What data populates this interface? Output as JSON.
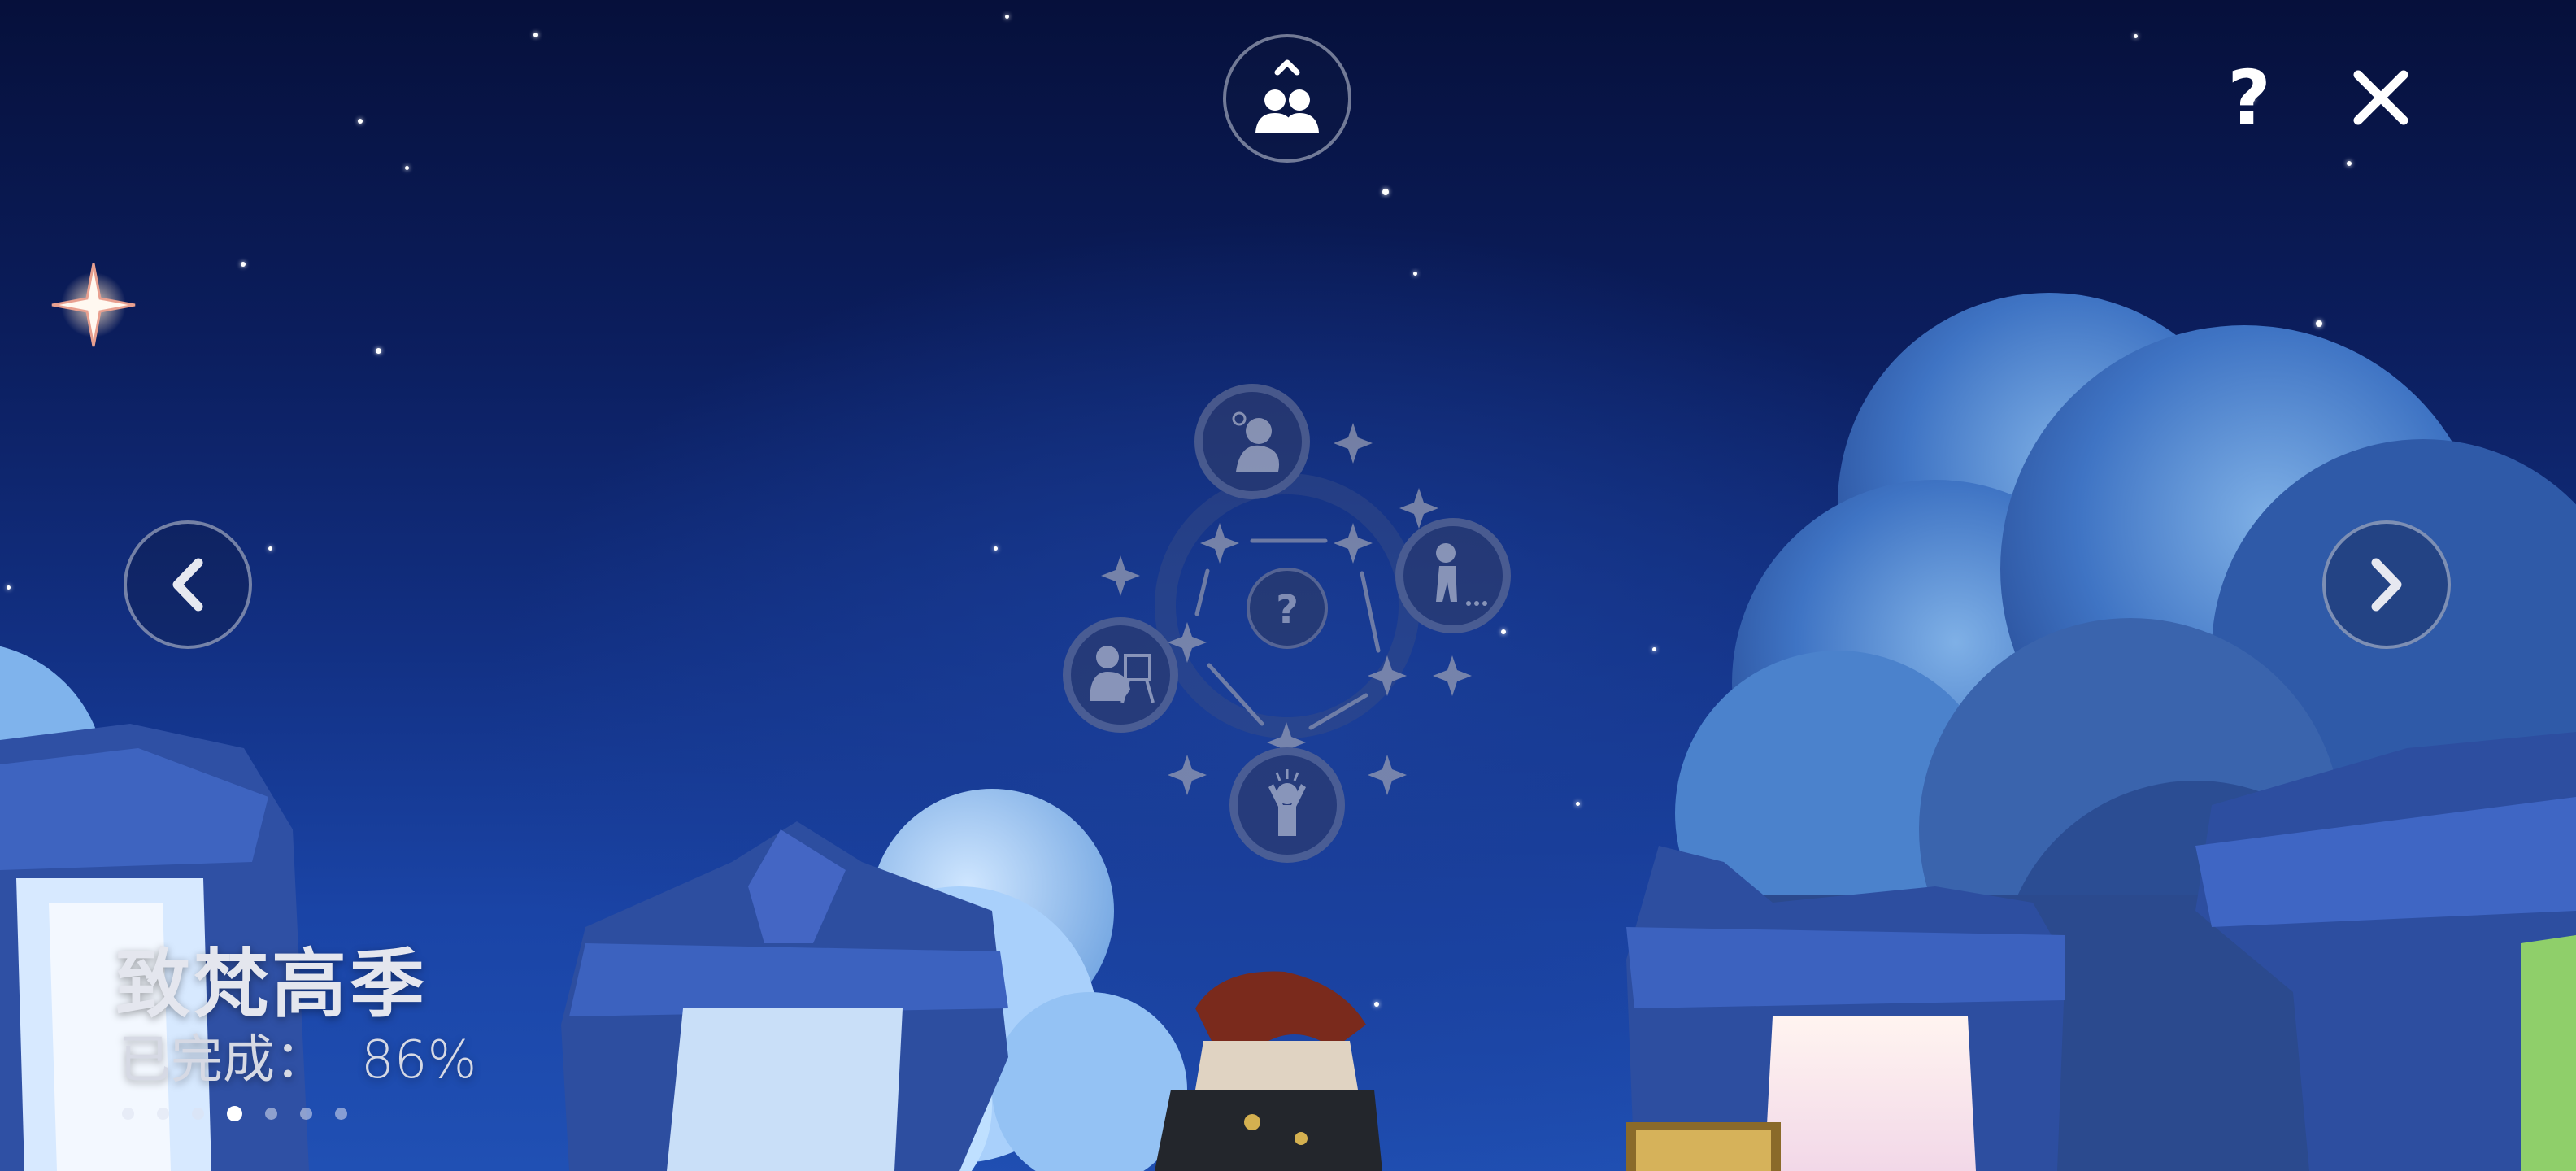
{
  "season": {
    "title": "致梵高季",
    "progress_label": "已完成：",
    "progress_value": "86%",
    "page_count": 7,
    "active_page": 4
  },
  "constellation": {
    "center_label": "?",
    "node_icons": [
      "thinking-person-icon",
      "crouching-person-icon",
      "painter-at-easel-icon",
      "cheering-person-icon"
    ]
  },
  "top_bar": {
    "friends_icon": "friends-icon",
    "help_label": "?",
    "close_icon": "close-icon"
  },
  "navigation": {
    "prev_icon": "chevron-left-icon",
    "next_icon": "chevron-right-icon"
  },
  "colors": {
    "sky_top": "#06103b",
    "sky_bottom": "#2050b4",
    "stone": "#3a5bb0",
    "constellation_line": "#8a90a8"
  }
}
